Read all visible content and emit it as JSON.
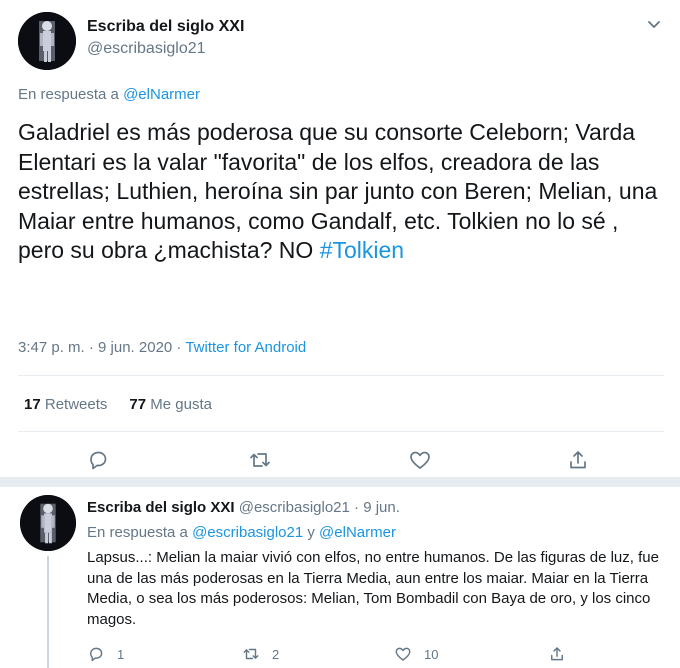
{
  "main": {
    "author_name": "Escriba del siglo XXI",
    "author_handle": "@escribasiglo21",
    "reply_prefix": "En respuesta a",
    "reply_mention": "@elNarmer",
    "text_body": "Galadriel es más poderosa que su consorte Celeborn; Varda Elentari es la valar \"favorita\" de los elfos, creadora de las estrellas; Luthien, heroína sin par junto con Beren; Melian, una Maiar entre humanos, como Gandalf, etc. Tolkien no lo sé , pero su obra ¿machista? NO ",
    "hashtag": "#Tolkien",
    "time_date": "3:47 p. m. · 9 jun. 2020 · ",
    "source": "Twitter for Android",
    "retweets_count": "17",
    "retweets_label": "Retweets",
    "likes_count": "77",
    "likes_label": "Me gusta"
  },
  "reply": {
    "author_name": "Escriba del siglo XXI",
    "author_handle": "@escribasiglo21",
    "date": "· 9 jun.",
    "reply_prefix": "En respuesta a",
    "mention_1": "@escribasiglo21",
    "conjunction": "y",
    "mention_2": "@elNarmer",
    "text": "Lapsus...: Melian la maiar vivió con elfos, no entre humanos. De las figuras de luz, fue una de las más poderosas en la Tierra Media, aun entre los maiar. Maiar en la Tierra Media, o sea los más poderosos: Melian, Tom Bombadil con Baya de oro, y los cinco magos.",
    "reply_count": "1",
    "retweet_count": "2",
    "like_count": "10"
  },
  "icons": [
    "reply-icon",
    "retweet-icon",
    "heart-icon",
    "share-icon",
    "chevron-down-icon"
  ],
  "colors": {
    "text": "#14171a",
    "secondary": "#657786",
    "link": "#1b95e0",
    "divider": "#e6ecf0"
  }
}
